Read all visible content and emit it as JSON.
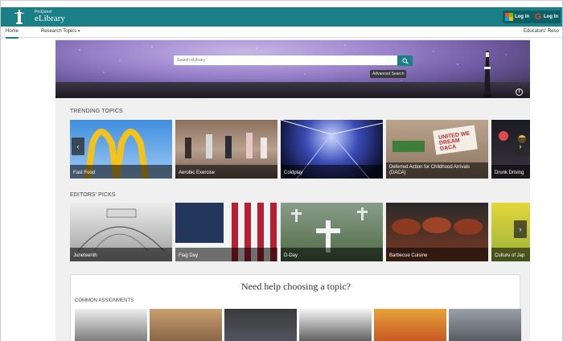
{
  "header": {
    "brand_small": "ProQuest",
    "brand_name": "eLibrary",
    "login_microsoft": "Log in",
    "login_google": "Log In",
    "colors": {
      "teal": "#1a7f86"
    }
  },
  "nav": {
    "home": "Home",
    "research": "Research Topics",
    "educators": "Educators' Reso"
  },
  "search": {
    "placeholder": "Search eLibrary",
    "advanced": "Advanced Search"
  },
  "trending": {
    "title": "TRENDING TOPICS",
    "cards": [
      {
        "label": "Fast Food"
      },
      {
        "label": "Aerobic Exercise"
      },
      {
        "label": "Coldplay"
      },
      {
        "label": "Deferred Action for Childhood Arrivals (DACA)"
      },
      {
        "label": "Drunk Driving"
      }
    ]
  },
  "editors": {
    "title": "EDITORS' PICKS",
    "cards": [
      {
        "label": "Juneteenth"
      },
      {
        "label": "Flag Day"
      },
      {
        "label": "D-Day"
      },
      {
        "label": "Barbecue Cuisine"
      },
      {
        "label": "Culture of Jap"
      }
    ]
  },
  "help": {
    "title": "Need help choosing a topic?",
    "common": "COMMON ASSIGNMENTS"
  },
  "image_text": {
    "daca_sign": "UNITED WE DREAM DACA"
  }
}
